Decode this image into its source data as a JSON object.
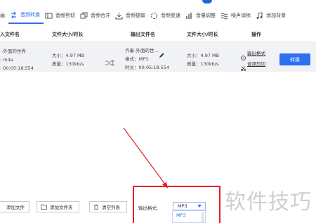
{
  "toolbar": {
    "items": [
      {
        "label": "画",
        "icon": "doc-icon"
      },
      {
        "label": "音频转换",
        "icon": "convert-icon"
      },
      {
        "label": "音频剪切",
        "icon": "cut-icon"
      },
      {
        "label": "音频合并",
        "icon": "merge-icon"
      },
      {
        "label": "音频提取",
        "icon": "extract-icon"
      },
      {
        "label": "音频变速",
        "icon": "speed-icon"
      },
      {
        "label": "音量调整",
        "icon": "volume-icon"
      },
      {
        "label": "噪声消除",
        "icon": "noise-icon"
      },
      {
        "label": "添加背景",
        "icon": "music-icon"
      }
    ],
    "accent": "#2e6ff1"
  },
  "table": {
    "headers": {
      "input_name": "入文件名",
      "size_duration": "文件大小/时长",
      "output_name": "输出文件名",
      "size_duration_out": "文件大小/时长",
      "action": "操作"
    },
    "row": {
      "input_name": "-外面的世界",
      "input_format": ": m4a",
      "input_duration": ": 00:05:18.554",
      "input_size": "大小：4.97 MB",
      "input_quality": "质量：130kb/s",
      "output_name": "齐秦-外面的世...",
      "output_format": "格式：MP3",
      "output_duration": "时长：00:05:18.554",
      "output_size": "大小：4.97 MB",
      "output_quality": "质量：130kb/s",
      "output_format_link": "输出格式",
      "cut_link": "音频剪切",
      "convert_button": "转换"
    }
  },
  "bottom": {
    "add_file": "添加文件",
    "add_folder": "添加文件夹",
    "clear_list": "清空列表",
    "output_format_label": "输出格式:",
    "format_selected": "MP3",
    "dropdown_option": "MP3"
  },
  "watermark": "软件技巧"
}
